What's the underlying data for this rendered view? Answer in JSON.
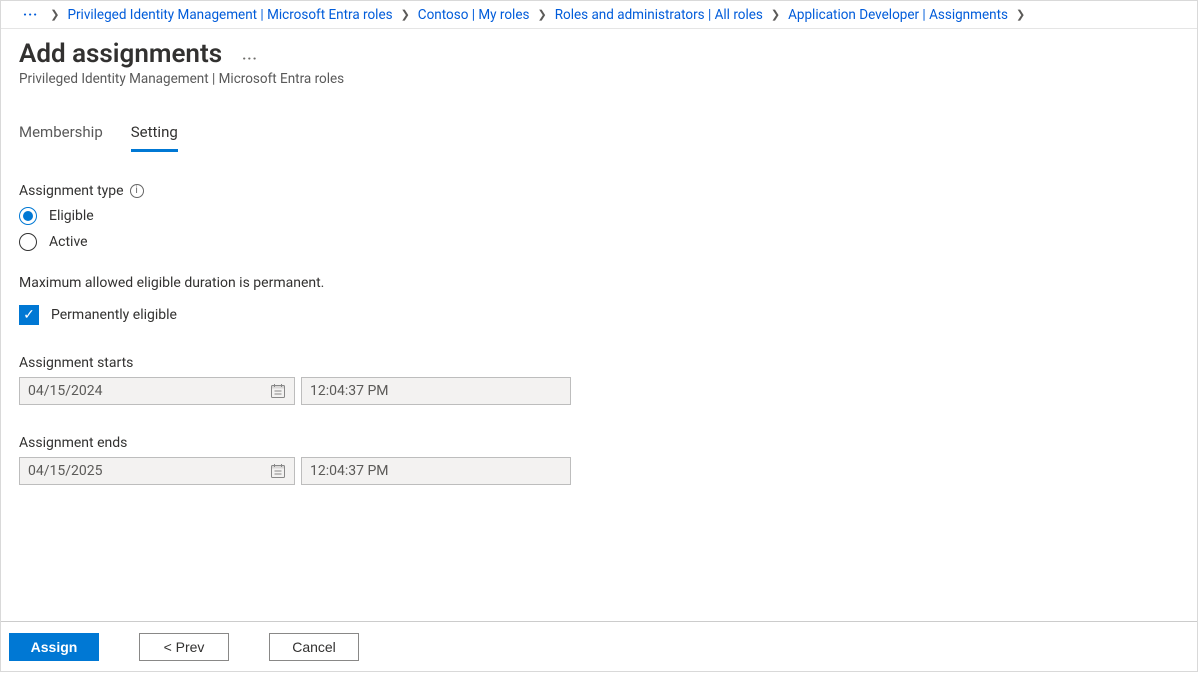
{
  "breadcrumb": {
    "ellipsis": "···",
    "items": [
      "Privileged Identity Management | Microsoft Entra roles",
      "Contoso | My roles",
      "Roles and administrators | All roles",
      "Application Developer | Assignments"
    ]
  },
  "header": {
    "title": "Add assignments",
    "subtitle": "Privileged Identity Management | Microsoft Entra roles",
    "more": "···"
  },
  "tabs": {
    "membership": "Membership",
    "setting": "Setting"
  },
  "setting": {
    "assignment_type_label": "Assignment type",
    "options": {
      "eligible": "Eligible",
      "active": "Active"
    },
    "duration_note": "Maximum allowed eligible duration is permanent.",
    "permanent_label": "Permanently eligible",
    "starts_label": "Assignment starts",
    "start_date": "04/15/2024",
    "start_time": "12:04:37 PM",
    "ends_label": "Assignment ends",
    "end_date": "04/15/2025",
    "end_time": "12:04:37 PM"
  },
  "footer": {
    "assign": "Assign",
    "prev": "<  Prev",
    "cancel": "Cancel"
  }
}
